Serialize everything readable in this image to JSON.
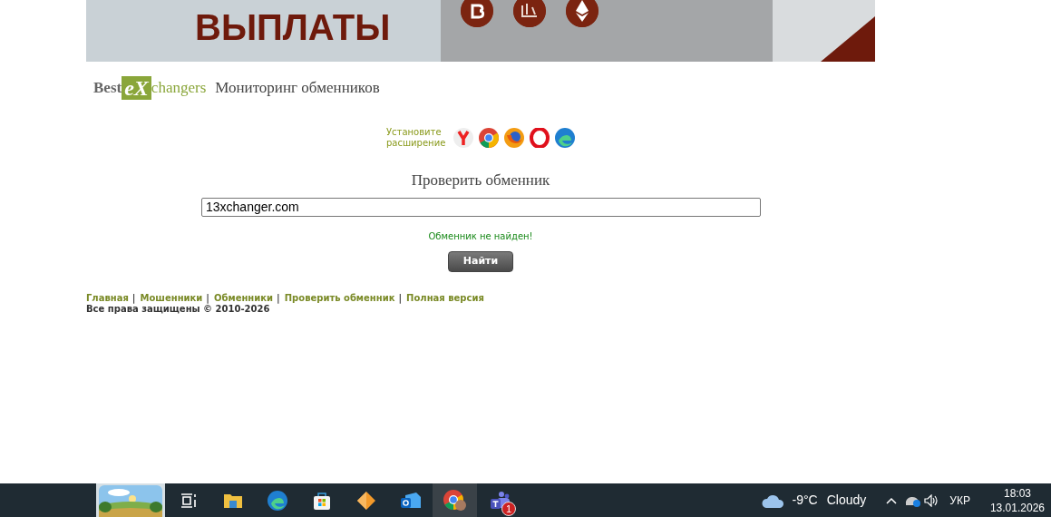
{
  "banner": {
    "headline": "ВЫПЛАТЫ"
  },
  "logo": {
    "prefix": "Best",
    "mark": "eX",
    "suffix": "changers",
    "tagline": "Мониторинг обменников"
  },
  "extension": {
    "label": "Установите расширение"
  },
  "check": {
    "title": "Проверить обменник",
    "value": "13xchanger.com",
    "message": "Обменник не найден!",
    "button": "Найти"
  },
  "footer": {
    "separator": "|",
    "links": [
      "Главная",
      "Мошенники",
      "Обменники",
      "Проверить обменник",
      "Полная версия"
    ],
    "copyright": "Все права защищены © 2010-2026"
  },
  "taskbar": {
    "apps": [
      {
        "kind": "taskview",
        "selected": false
      },
      {
        "kind": "folder",
        "selected": false
      },
      {
        "kind": "edge",
        "selected": false
      },
      {
        "kind": "store",
        "selected": false
      },
      {
        "kind": "shapes",
        "selected": false
      },
      {
        "kind": "mail",
        "selected": false
      },
      {
        "kind": "chrome",
        "selected": true
      },
      {
        "kind": "teams",
        "selected": false,
        "badge": "1"
      }
    ],
    "weather": {
      "temperature": "-9°C",
      "condition": "Cloudy"
    },
    "language": "УКР",
    "time": "18:03",
    "date": "13.01.2026"
  }
}
